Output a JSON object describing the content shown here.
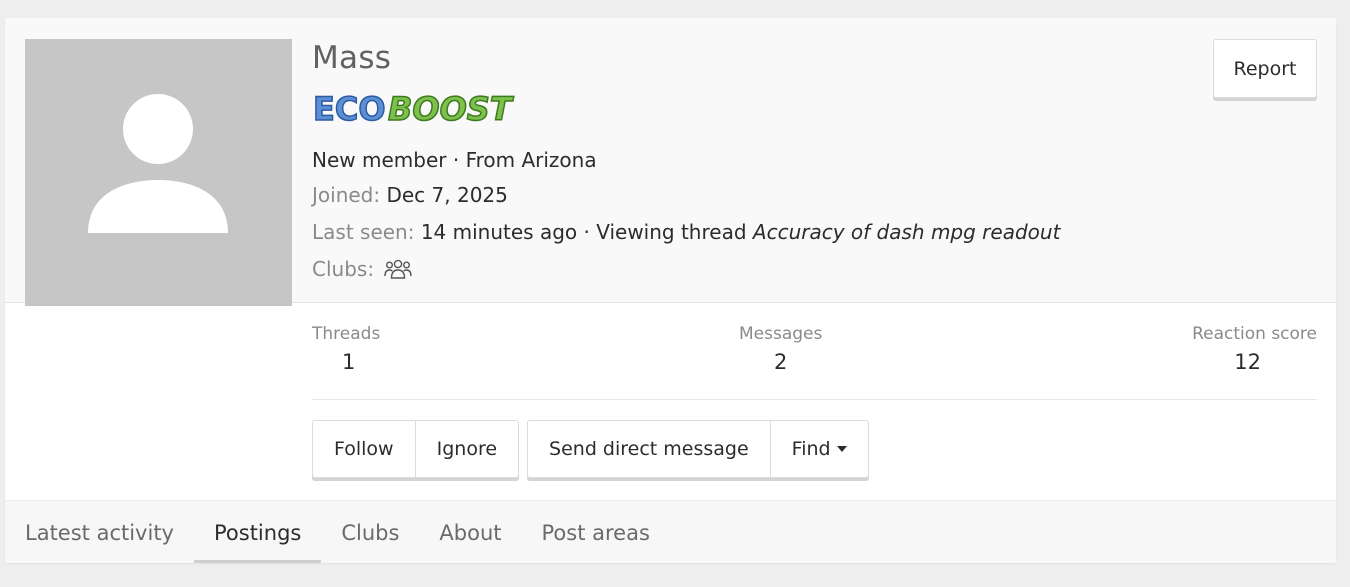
{
  "profile": {
    "username": "Mass",
    "banner_text_1": "ECO",
    "banner_text_2": "BOOST",
    "title": "New member",
    "separator": " · ",
    "location": "From Arizona",
    "joined_label": "Joined:",
    "joined_value": "Dec 7, 2025",
    "last_seen_label": "Last seen:",
    "last_seen_value": "14 minutes ago",
    "viewing_prefix": "Viewing thread",
    "viewing_thread": "Accuracy of dash mpg readout",
    "clubs_label": "Clubs:"
  },
  "actions": {
    "report": "Report",
    "follow": "Follow",
    "ignore": "Ignore",
    "send_dm": "Send direct message",
    "find": "Find"
  },
  "stats": {
    "threads_label": "Threads",
    "threads_value": "1",
    "messages_label": "Messages",
    "messages_value": "2",
    "reaction_label": "Reaction score",
    "reaction_value": "12"
  },
  "tabs": [
    {
      "label": "Latest activity",
      "active": false
    },
    {
      "label": "Postings",
      "active": true
    },
    {
      "label": "Clubs",
      "active": false
    },
    {
      "label": "About",
      "active": false
    },
    {
      "label": "Post areas",
      "active": false
    }
  ],
  "colors": {
    "eco_blue": "#5b8fd8",
    "boost_green": "#7dc04b",
    "avatar_bg": "#c6c6c6"
  },
  "icons": {
    "clubs": "users-icon",
    "avatar": "default-avatar-icon",
    "find_caret": "caret-down-icon"
  }
}
